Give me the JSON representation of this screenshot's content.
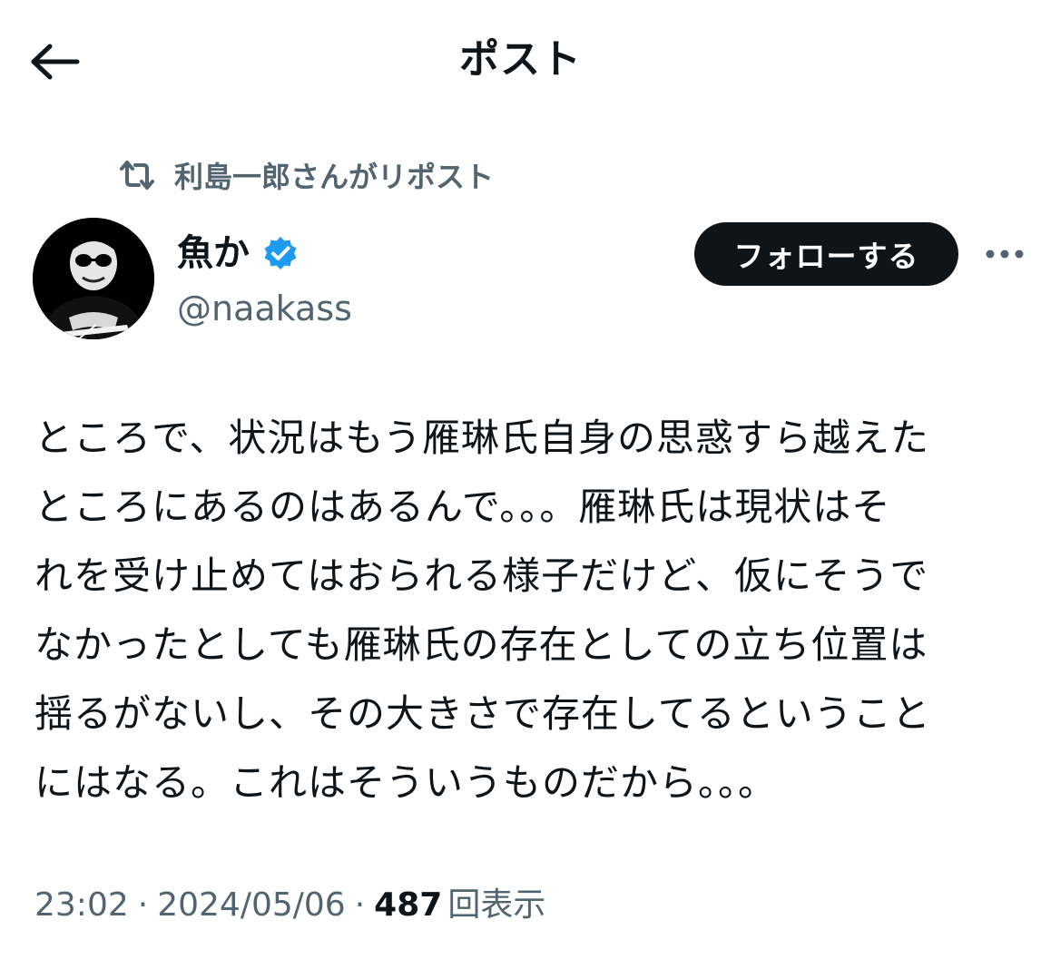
{
  "header": {
    "title": "ポスト",
    "back_icon": "arrow-left-icon"
  },
  "repost": {
    "icon": "repost-icon",
    "text": "利島一郎さんがリポスト"
  },
  "author": {
    "display_name": "魚か",
    "verified_icon": "verified-badge-icon",
    "handle": "@naakass"
  },
  "actions": {
    "follow_label": "フォローする",
    "more_icon": "more-horizontal-icon"
  },
  "post": {
    "text": "ところで、状況はもう雁琳氏自身の思惑すら越えた\nところにあるのはあるんで。。。雁琳氏は現状はそ\nれを受け止めてはおられる様子だけど、仮にそうで\nなかったとしても雁琳氏の存在としての立ち位置は\n揺るがないし、その大きさで存在してるということ\nにはなる。これはそういうものだから。。。"
  },
  "meta": {
    "time": "23:02",
    "separator": "·",
    "date": "2024/05/06",
    "views_count": "487",
    "views_label": "回表示"
  },
  "colors": {
    "text": "#0f1419",
    "secondary": "#536471",
    "verified": "#1d9bf0",
    "follow_bg": "#0f1419"
  }
}
